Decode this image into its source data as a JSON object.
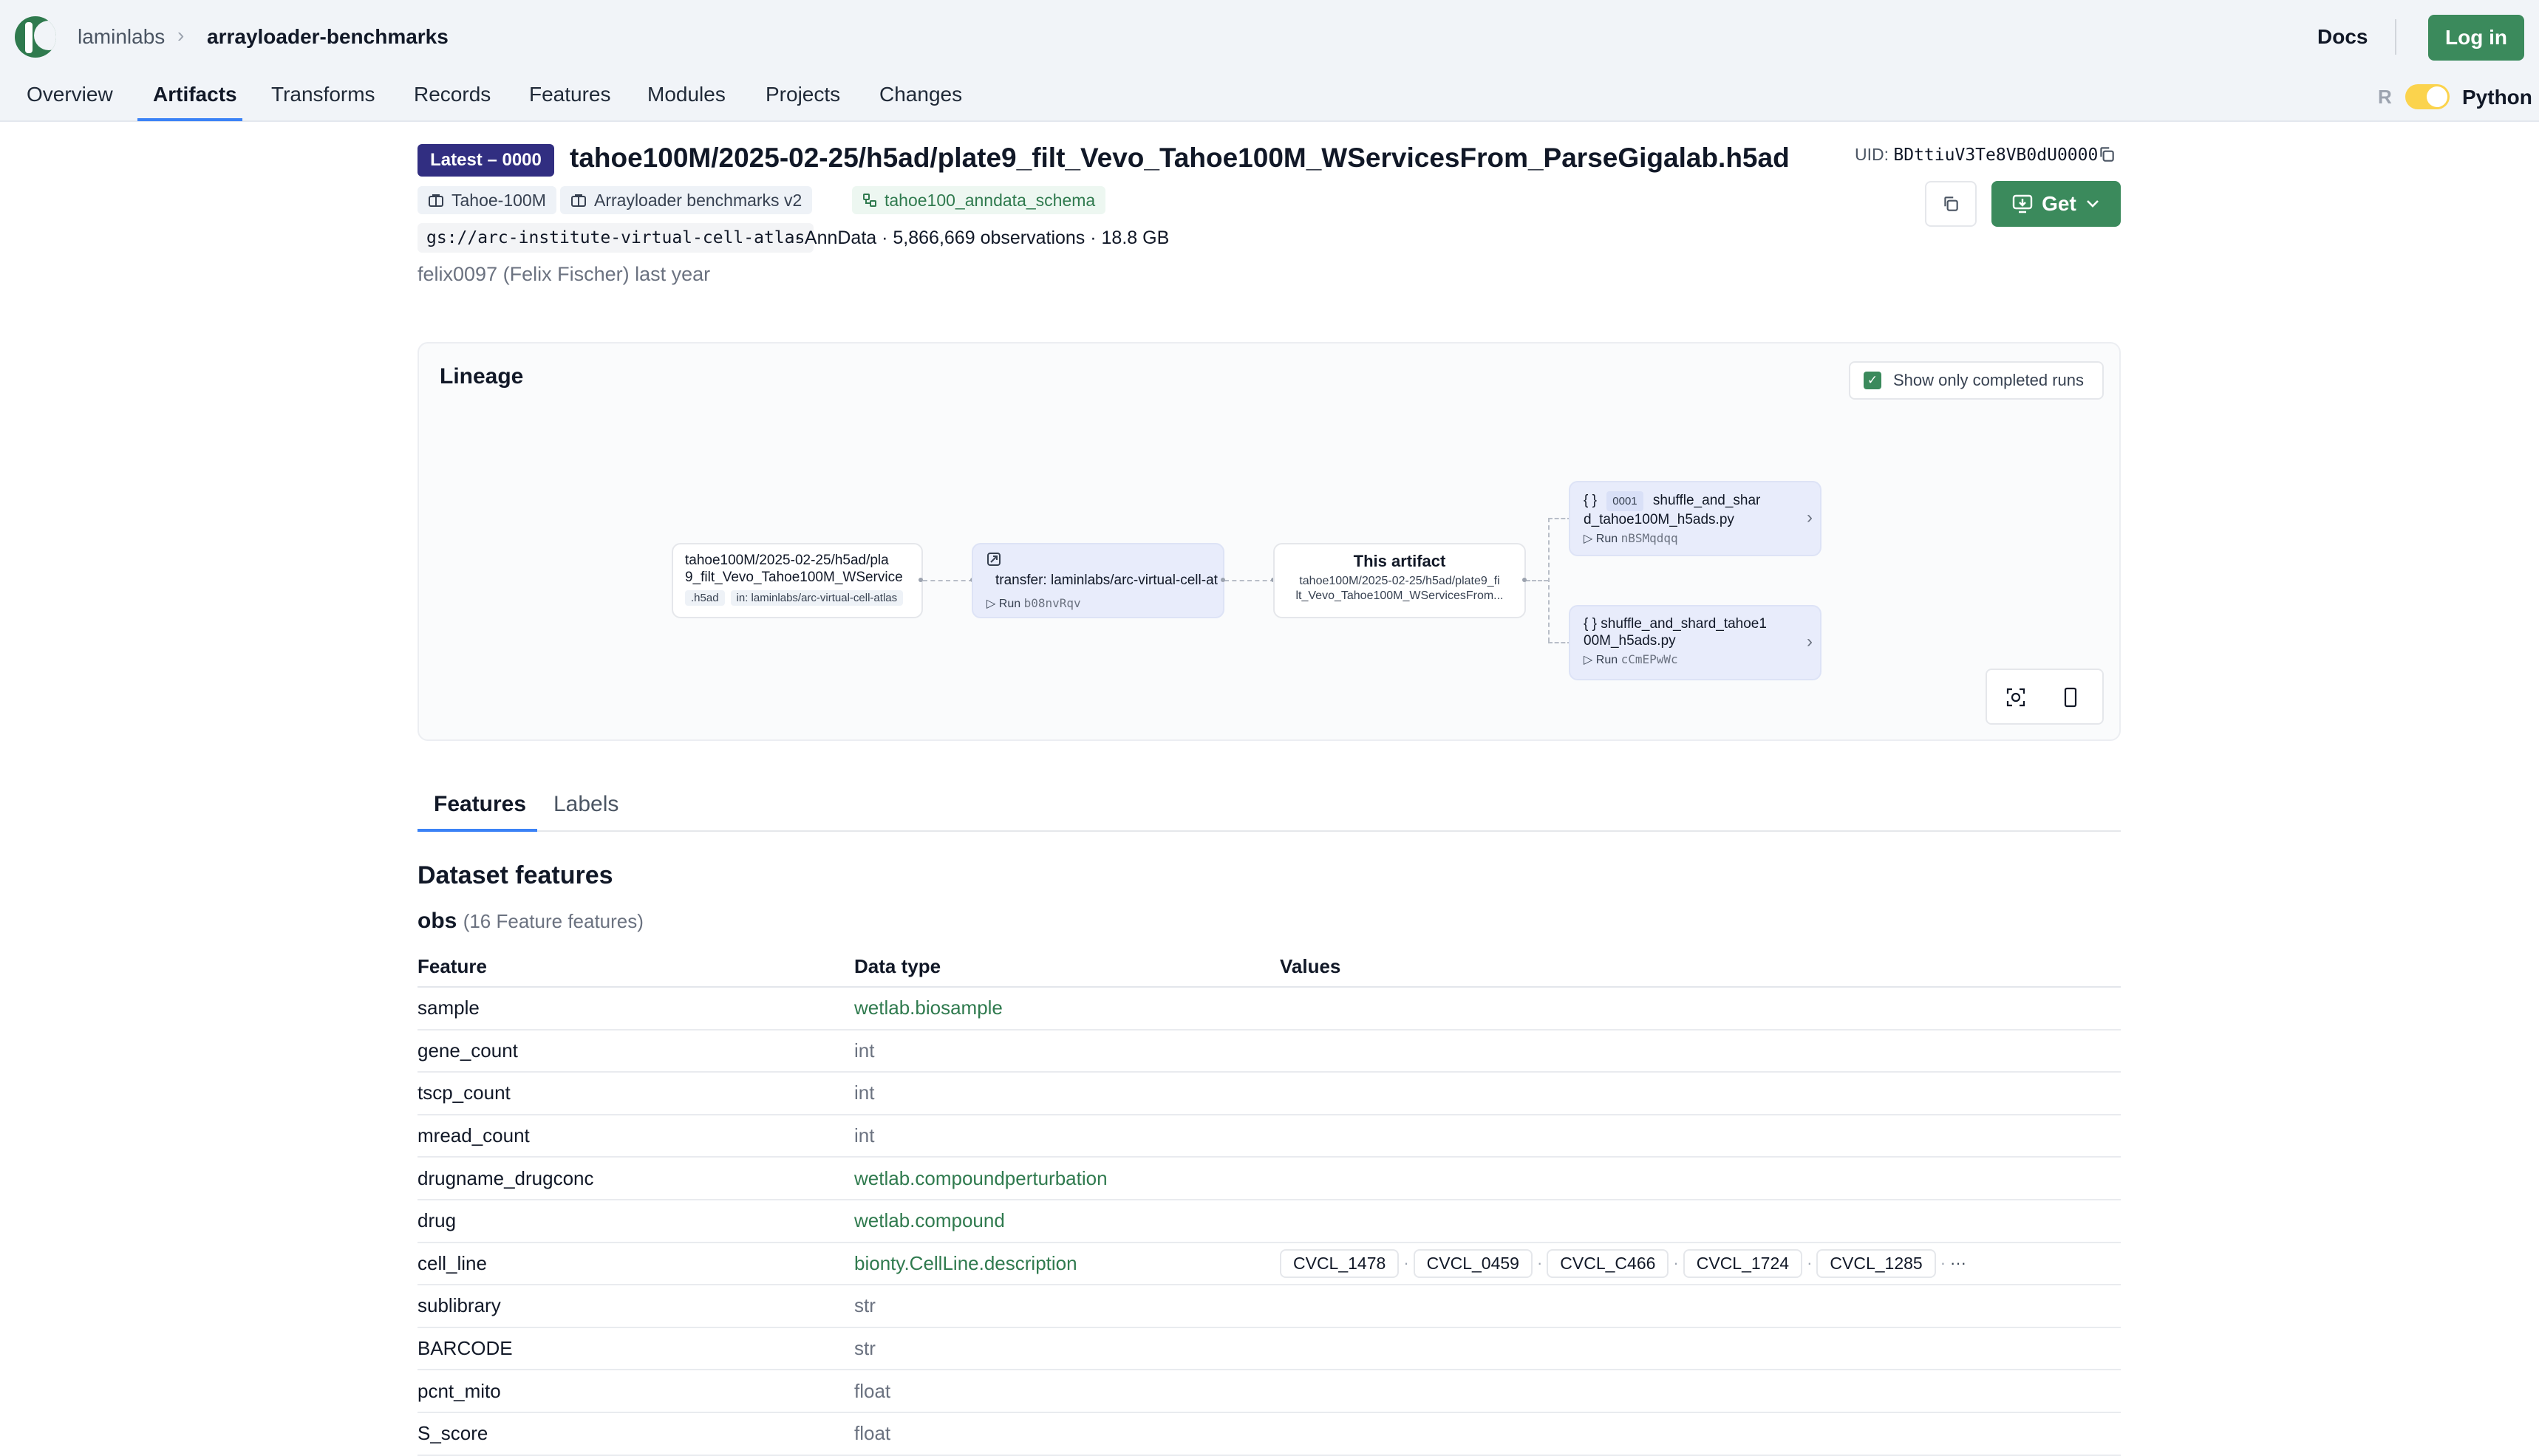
{
  "header": {
    "org": "laminlabs",
    "separator": "›",
    "repo": "arrayloader-benchmarks",
    "docs_label": "Docs",
    "login_label": "Log in"
  },
  "nav": {
    "items": [
      "Overview",
      "Artifacts",
      "Transforms",
      "Records",
      "Features",
      "Modules",
      "Projects",
      "Changes"
    ],
    "active": "Artifacts"
  },
  "language": {
    "r_label": "R",
    "python_label": "Python",
    "selected": "Python"
  },
  "artifact": {
    "version_badge": "Latest – 0000",
    "title": "tahoe100M/2025-02-25/h5ad/plate9_filt_Vevo_Tahoe100M_WServicesFrom_ParseGigalab.h5ad",
    "uid_label": "UID:",
    "uid": "BDttiuV3Te8VB0dU0000",
    "tags": [
      {
        "label": "Tahoe-100M",
        "icon": "project-icon"
      },
      {
        "label": "Arrayloader benchmarks v2",
        "icon": "project-icon"
      },
      {
        "label": "tahoe100_anndata_schema",
        "icon": "schema-icon"
      }
    ],
    "storage": "gs://arc-institute-virtual-cell-atlas",
    "meta": "· AnnData · 5,866,669 observations · 18.8 GB",
    "author": "felix0097 (Felix Fischer) last year",
    "get_label": "Get"
  },
  "lineage": {
    "title": "Lineage",
    "toggle_label": "Show only completed runs",
    "toggle_checked": true,
    "input_node": {
      "line1": "tahoe100M/2025-02-25/h5ad/pla",
      "line2": "9_filt_Vevo_Tahoe100M_WService",
      "chip1": ".h5ad",
      "chip2": "in: laminlabs/arc-virtual-cell-atlas"
    },
    "transfer_node": {
      "label": "transfer: laminlabs/arc-virtual-cell-at",
      "run_label": "Run",
      "run_id": "b08nvRqv"
    },
    "this_node": {
      "title": "This artifact",
      "line1": "tahoe100M/2025-02-25/h5ad/plate9_fi",
      "line2": "lt_Vevo_Tahoe100M_WServicesFrom..."
    },
    "out_node_1": {
      "icon": "{ }",
      "version": "0001",
      "line1": "shuffle_and_shar",
      "line2": "d_tahoe100M_h5ads.py",
      "run_label": "Run",
      "run_id": "nBSMqdqq"
    },
    "out_node_2": {
      "icon": "{ }",
      "line1": "shuffle_and_shard_tahoe1",
      "line2": "00M_h5ads.py",
      "run_label": "Run",
      "run_id": "cCmEPwWc"
    }
  },
  "tabs": [
    "Features",
    "Labels"
  ],
  "active_tab": "Features",
  "dataset": {
    "section_title": "Dataset features",
    "slot": "obs",
    "slot_note": "(16 Feature features)",
    "columns": [
      "Feature",
      "Data type",
      "Values"
    ],
    "rows": [
      {
        "feature": "sample",
        "dtype": "wetlab.biosample",
        "registry": true
      },
      {
        "feature": "gene_count",
        "dtype": "int",
        "registry": false
      },
      {
        "feature": "tscp_count",
        "dtype": "int",
        "registry": false
      },
      {
        "feature": "mread_count",
        "dtype": "int",
        "registry": false
      },
      {
        "feature": "drugname_drugconc",
        "dtype": "wetlab.compoundperturbation",
        "registry": true
      },
      {
        "feature": "drug",
        "dtype": "wetlab.compound",
        "registry": true
      },
      {
        "feature": "cell_line",
        "dtype": "bionty.CellLine.description",
        "registry": true,
        "values": [
          "CVCL_1478",
          "CVCL_0459",
          "CVCL_C466",
          "CVCL_1724",
          "CVCL_1285"
        ],
        "more": "···"
      },
      {
        "feature": "sublibrary",
        "dtype": "str",
        "registry": false
      },
      {
        "feature": "BARCODE",
        "dtype": "str",
        "registry": false
      },
      {
        "feature": "pcnt_mito",
        "dtype": "float",
        "registry": false
      },
      {
        "feature": "S_score",
        "dtype": "float",
        "registry": false
      }
    ]
  },
  "colors": {
    "brand_green": "#3b8a5c",
    "badge_indigo": "#312e81",
    "active_underline": "#3b82f6",
    "run_node_bg": "#e8ecfb"
  }
}
